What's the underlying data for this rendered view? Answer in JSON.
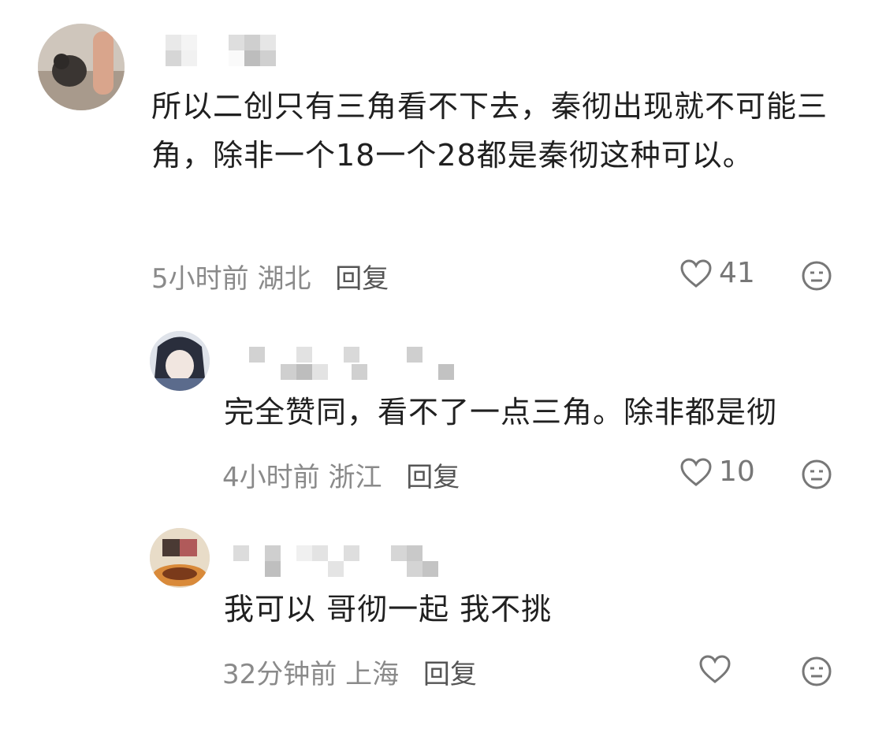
{
  "comments": [
    {
      "text": "所以二创只有三角看不下去，秦彻出现就不可能三角，除非一个18一个28都是秦彻这种可以。",
      "time": "5小时前",
      "location": "湖北",
      "reply": "回复",
      "likes": "41",
      "avatar_icon": "cat-avatar-icon"
    },
    {
      "text": "完全赞同，看不了一点三角。除非都是彻",
      "time": "4小时前",
      "location": "浙江",
      "reply": "回复",
      "likes": "10",
      "avatar_icon": "anime-avatar-icon"
    },
    {
      "text": "我可以 哥彻一起 我不挑",
      "time": "32分钟前",
      "location": "上海",
      "reply": "回复",
      "likes": "",
      "avatar_icon": "food-avatar-icon"
    }
  ],
  "colors": {
    "text": "#202020",
    "meta": "#8a8a8a",
    "reply": "#555555",
    "icon": "#777777"
  }
}
